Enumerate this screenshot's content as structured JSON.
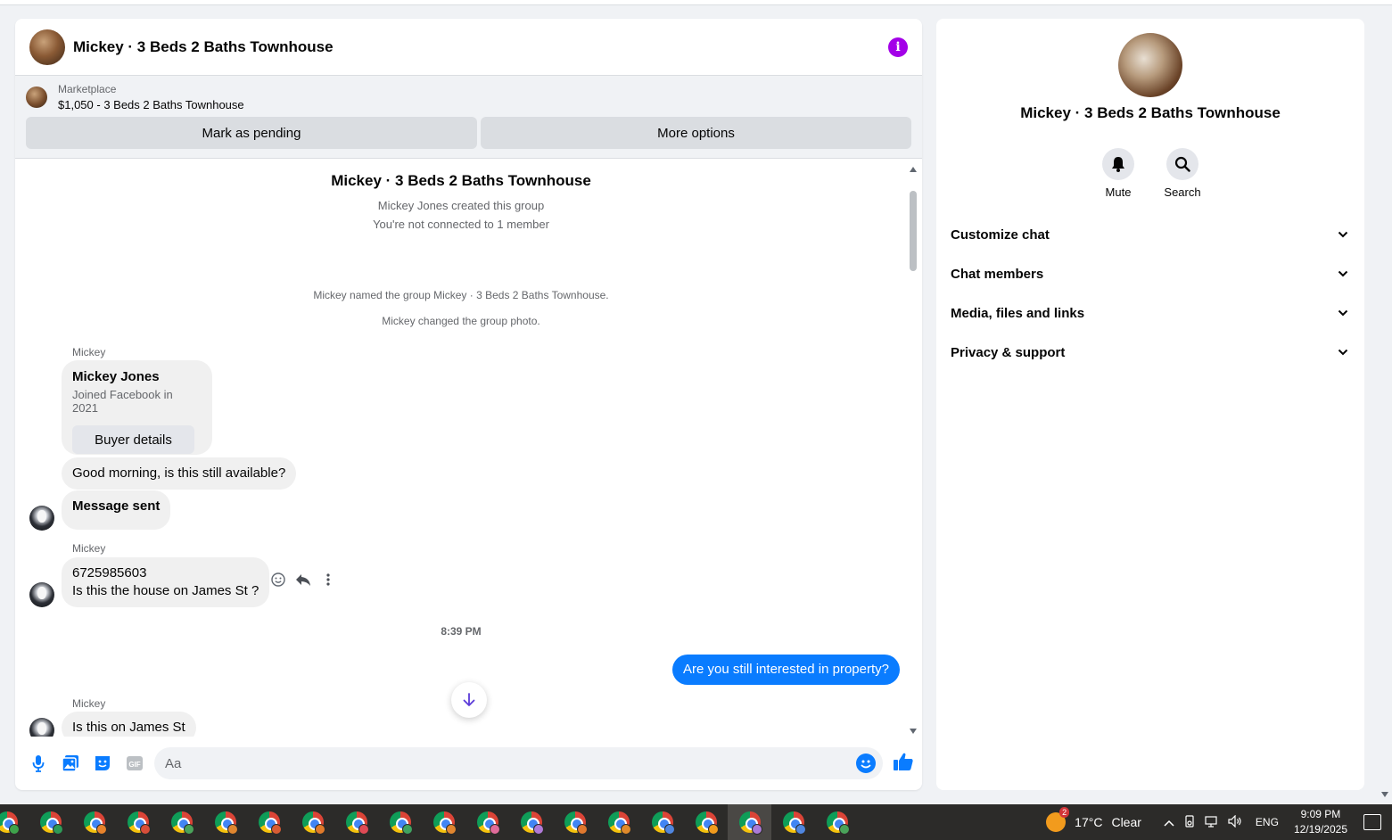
{
  "chat": {
    "title": "Mickey · 3 Beds 2 Baths Townhouse",
    "info_icon": "info-icon",
    "marketplace": {
      "label": "Marketplace",
      "listing": "$1,050 - 3 Beds 2 Baths Townhouse",
      "mark_pending": "Mark as pending",
      "more_options": "More options"
    },
    "group_title": "Mickey · 3 Beds 2 Baths Townhouse",
    "created": "Mickey Jones created this group",
    "not_connected": "You're not connected to 1 member",
    "named": "Mickey named the group Mickey · 3 Beds 2 Baths Townhouse.",
    "changed_photo": "Mickey changed the group photo.",
    "card": {
      "sender": "Mickey",
      "name": "Mickey Jones",
      "joined": "Joined Facebook in 2021",
      "button": "Buyer details"
    },
    "msg1": "Good morning, is this still available?",
    "msg2": "Message sent",
    "msg3_sender": "Mickey",
    "msg3_line1": "6725985603",
    "msg3_line2": "Is this the house on James St ?",
    "time": "8:39 PM",
    "outgoing": "Are you still interested in property?",
    "msg4_sender": "Mickey",
    "msg4": "Is this on James St",
    "composer_placeholder": "Aa"
  },
  "side": {
    "title": "Mickey · 3 Beds 2 Baths Townhouse",
    "mute": "Mute",
    "search": "Search",
    "sections": [
      "Customize chat",
      "Chat members",
      "Media, files and links",
      "Privacy & support"
    ]
  },
  "taskbar": {
    "weather_badge": "2",
    "temperature": "17°C",
    "condition": "Clear",
    "language": "ENG",
    "time": "9:09 PM",
    "date": "12/19/2025",
    "profile_colors": [
      "#3ea34b",
      "#2d9b57",
      "#e8832b",
      "#d84e3a",
      "#4aa35a",
      "#e0862f",
      "#d85c34",
      "#e07a2a",
      "#e04a55",
      "#3fa360",
      "#e0862f",
      "#e06b9a",
      "#b07ad8",
      "#e0782e",
      "#e08a2b",
      "#4f86e0",
      "#f29b1d",
      "#a97ad8",
      "#4f86e0",
      "#4aa35a"
    ]
  }
}
